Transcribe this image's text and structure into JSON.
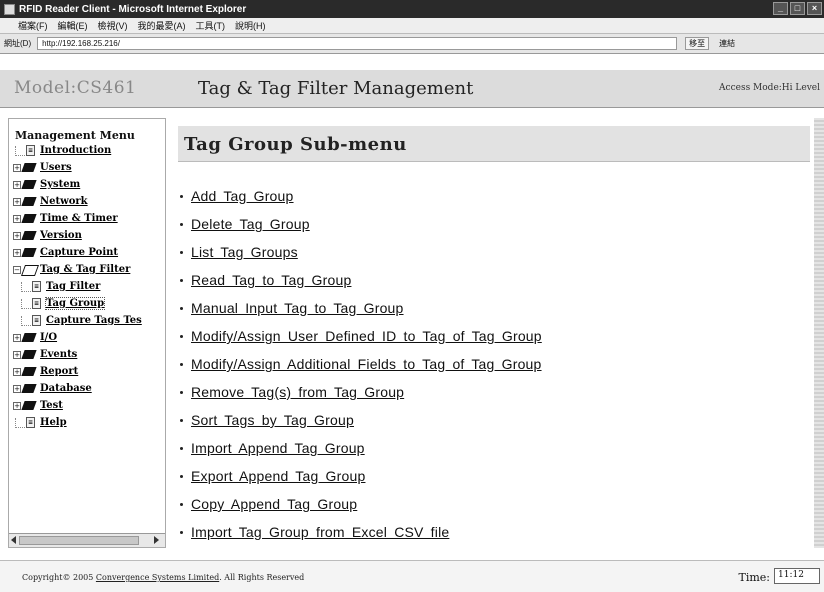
{
  "window": {
    "title": "RFID Reader Client - Microsoft Internet Explorer"
  },
  "menubar": {
    "items": [
      "檔案(F)",
      "編輯(E)",
      "檢視(V)",
      "我的最愛(A)",
      "工具(T)",
      "說明(H)"
    ]
  },
  "addressbar": {
    "label": "網址(D)",
    "url": "http://192.168.25.216/",
    "go_label": "移至",
    "links_label": "連結"
  },
  "header": {
    "model": "Model:CS461",
    "title": "Tag & Tag Filter Management",
    "access_mode": "Access Mode:Hi Level"
  },
  "sidebar": {
    "menu_title": "Management Menu",
    "items": [
      {
        "label": "Introduction",
        "type": "doc",
        "level": 0
      },
      {
        "label": "Users",
        "type": "book",
        "level": 0
      },
      {
        "label": "System",
        "type": "book",
        "level": 0
      },
      {
        "label": "Network",
        "type": "book",
        "level": 0
      },
      {
        "label": "Time & Timer",
        "type": "book",
        "level": 0
      },
      {
        "label": "Version",
        "type": "book",
        "level": 0
      },
      {
        "label": "Capture Point",
        "type": "book",
        "level": 0
      },
      {
        "label": "Tag & Tag Filter",
        "type": "book-open",
        "level": 0
      },
      {
        "label": "Tag Filter",
        "type": "doc",
        "level": 1
      },
      {
        "label": "Tag Group",
        "type": "doc",
        "level": 1,
        "selected": true
      },
      {
        "label": "Capture Tags Tes",
        "type": "doc",
        "level": 1
      },
      {
        "label": "I/O",
        "type": "book",
        "level": 0
      },
      {
        "label": "Events",
        "type": "book",
        "level": 0
      },
      {
        "label": "Report",
        "type": "book",
        "level": 0
      },
      {
        "label": "Database",
        "type": "book",
        "level": 0
      },
      {
        "label": "Test",
        "type": "book",
        "level": 0
      },
      {
        "label": "Help",
        "type": "doc",
        "level": 0
      }
    ]
  },
  "main": {
    "sub_title": "Tag Group Sub-menu",
    "links": [
      "Add Tag Group",
      "Delete Tag Group",
      "List Tag Groups",
      "Read Tag to Tag Group",
      "Manual Input Tag to Tag Group",
      "Modify/Assign User Defined ID to Tag of Tag Group",
      "Modify/Assign Additional Fields to Tag of Tag Group",
      "Remove Tag(s) from Tag Group",
      "Sort Tags by Tag Group",
      "Import Append Tag Group",
      "Export Append Tag Group",
      "Copy Append Tag Group",
      "Import Tag Group from Excel CSV file"
    ]
  },
  "footer": {
    "copyright_prefix": "Copyright© 2005 ",
    "company_link": "Convergence Systems Limited",
    "copyright_suffix": ". All Rights Reserved",
    "time_label": "Time:",
    "time_value": "11:12"
  }
}
